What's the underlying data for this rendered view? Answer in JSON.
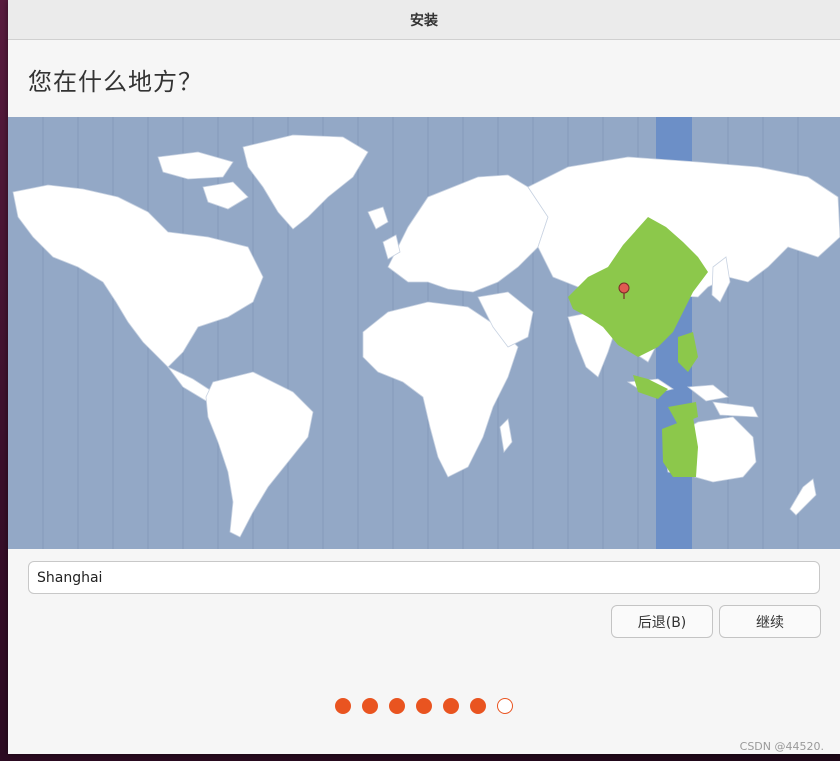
{
  "window": {
    "title": "安装"
  },
  "page": {
    "heading": "您在什么地方？"
  },
  "map": {
    "ocean_color": "#93a8c6",
    "land_color": "#ffffff",
    "selected_region_color": "#8cc84b",
    "selected_band_color": "#6c8fc7",
    "marker_color": "#e05a52"
  },
  "location": {
    "value": "Shanghai"
  },
  "buttons": {
    "back": "后退(B)",
    "continue": "继续"
  },
  "progress": {
    "total_steps": 7,
    "completed_steps": 6,
    "accent": "#e95420"
  },
  "watermark": "CSDN @44520."
}
